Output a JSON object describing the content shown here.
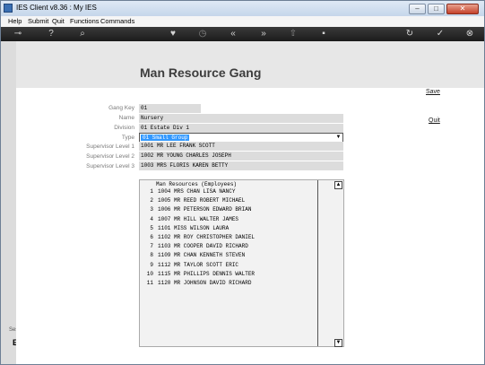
{
  "window": {
    "title": "IES Client v8.36 : My IES"
  },
  "menu": [
    "Help",
    "Submit",
    "Quit",
    "Functions",
    "Commands"
  ],
  "toolbar_icons": [
    "key-icon",
    "help-icon",
    "search-icon",
    "heart-icon",
    "clock-icon",
    "rewind-icon",
    "fast-forward-icon",
    "upload-icon",
    "stop-icon",
    "refresh-icon",
    "check-icon",
    "close-icon"
  ],
  "toolbar_glyphs": {
    "key": "⊸",
    "help": "?",
    "search": "⌕",
    "heart": "♥",
    "clock": "◷",
    "rewind": "«",
    "ff": "»",
    "upload": "⇧",
    "stop": "▪",
    "refresh": "↻",
    "check": "✓",
    "close": "⊗"
  },
  "page": {
    "title": "Man Resource Gang",
    "save_link": "Save",
    "quit_link": "Quit"
  },
  "form": {
    "gang_key": {
      "label": "Gang Key",
      "value": "01"
    },
    "name": {
      "label": "Name",
      "value": "Nursery"
    },
    "division": {
      "label": "Division",
      "value": "01 Estate Div 1"
    },
    "type": {
      "label": "Type",
      "value": "01 Small Group"
    },
    "supervisor1": {
      "label": "Supervisor Level 1",
      "value": "1001 MR LEE FRANK SCOTT"
    },
    "supervisor2": {
      "label": "Supervisor Level 2",
      "value": "1002 MR YOUNG CHARLES JOSEPH"
    },
    "supervisor3": {
      "label": "Supervisor Level 3",
      "value": "1003 MRS FLORIS KAREN BETTY"
    }
  },
  "resources": {
    "header": "Man Resources (Employees)",
    "rows": [
      {
        "no": "1",
        "text": "1004 MRS CHAN LISA NANCY"
      },
      {
        "no": "2",
        "text": "1005 MR REED ROBERT MICHAEL"
      },
      {
        "no": "3",
        "text": "1006 MR PETERSON EDWARD BRIAN"
      },
      {
        "no": "4",
        "text": "1007 MR HILL WALTER JAMES"
      },
      {
        "no": "5",
        "text": "1101 MISS WILSON LAURA"
      },
      {
        "no": "6",
        "text": "1102 MR ROY CHRISTOPHER DANIEL"
      },
      {
        "no": "7",
        "text": "1103 MR COOPER DAVID RICHARD"
      },
      {
        "no": "8",
        "text": "1109 MR CHAN KENNETH STEVEN"
      },
      {
        "no": "9",
        "text": "1112 MR TAYLOR SCOTT ERIC"
      },
      {
        "no": "10",
        "text": "1115 MR PHILLIPS DENNIS WALTER"
      },
      {
        "no": "11",
        "text": "1120 MR JOHNSON DAVID RICHARD"
      }
    ]
  },
  "side": {
    "label": "Ses",
    "char": "E"
  }
}
